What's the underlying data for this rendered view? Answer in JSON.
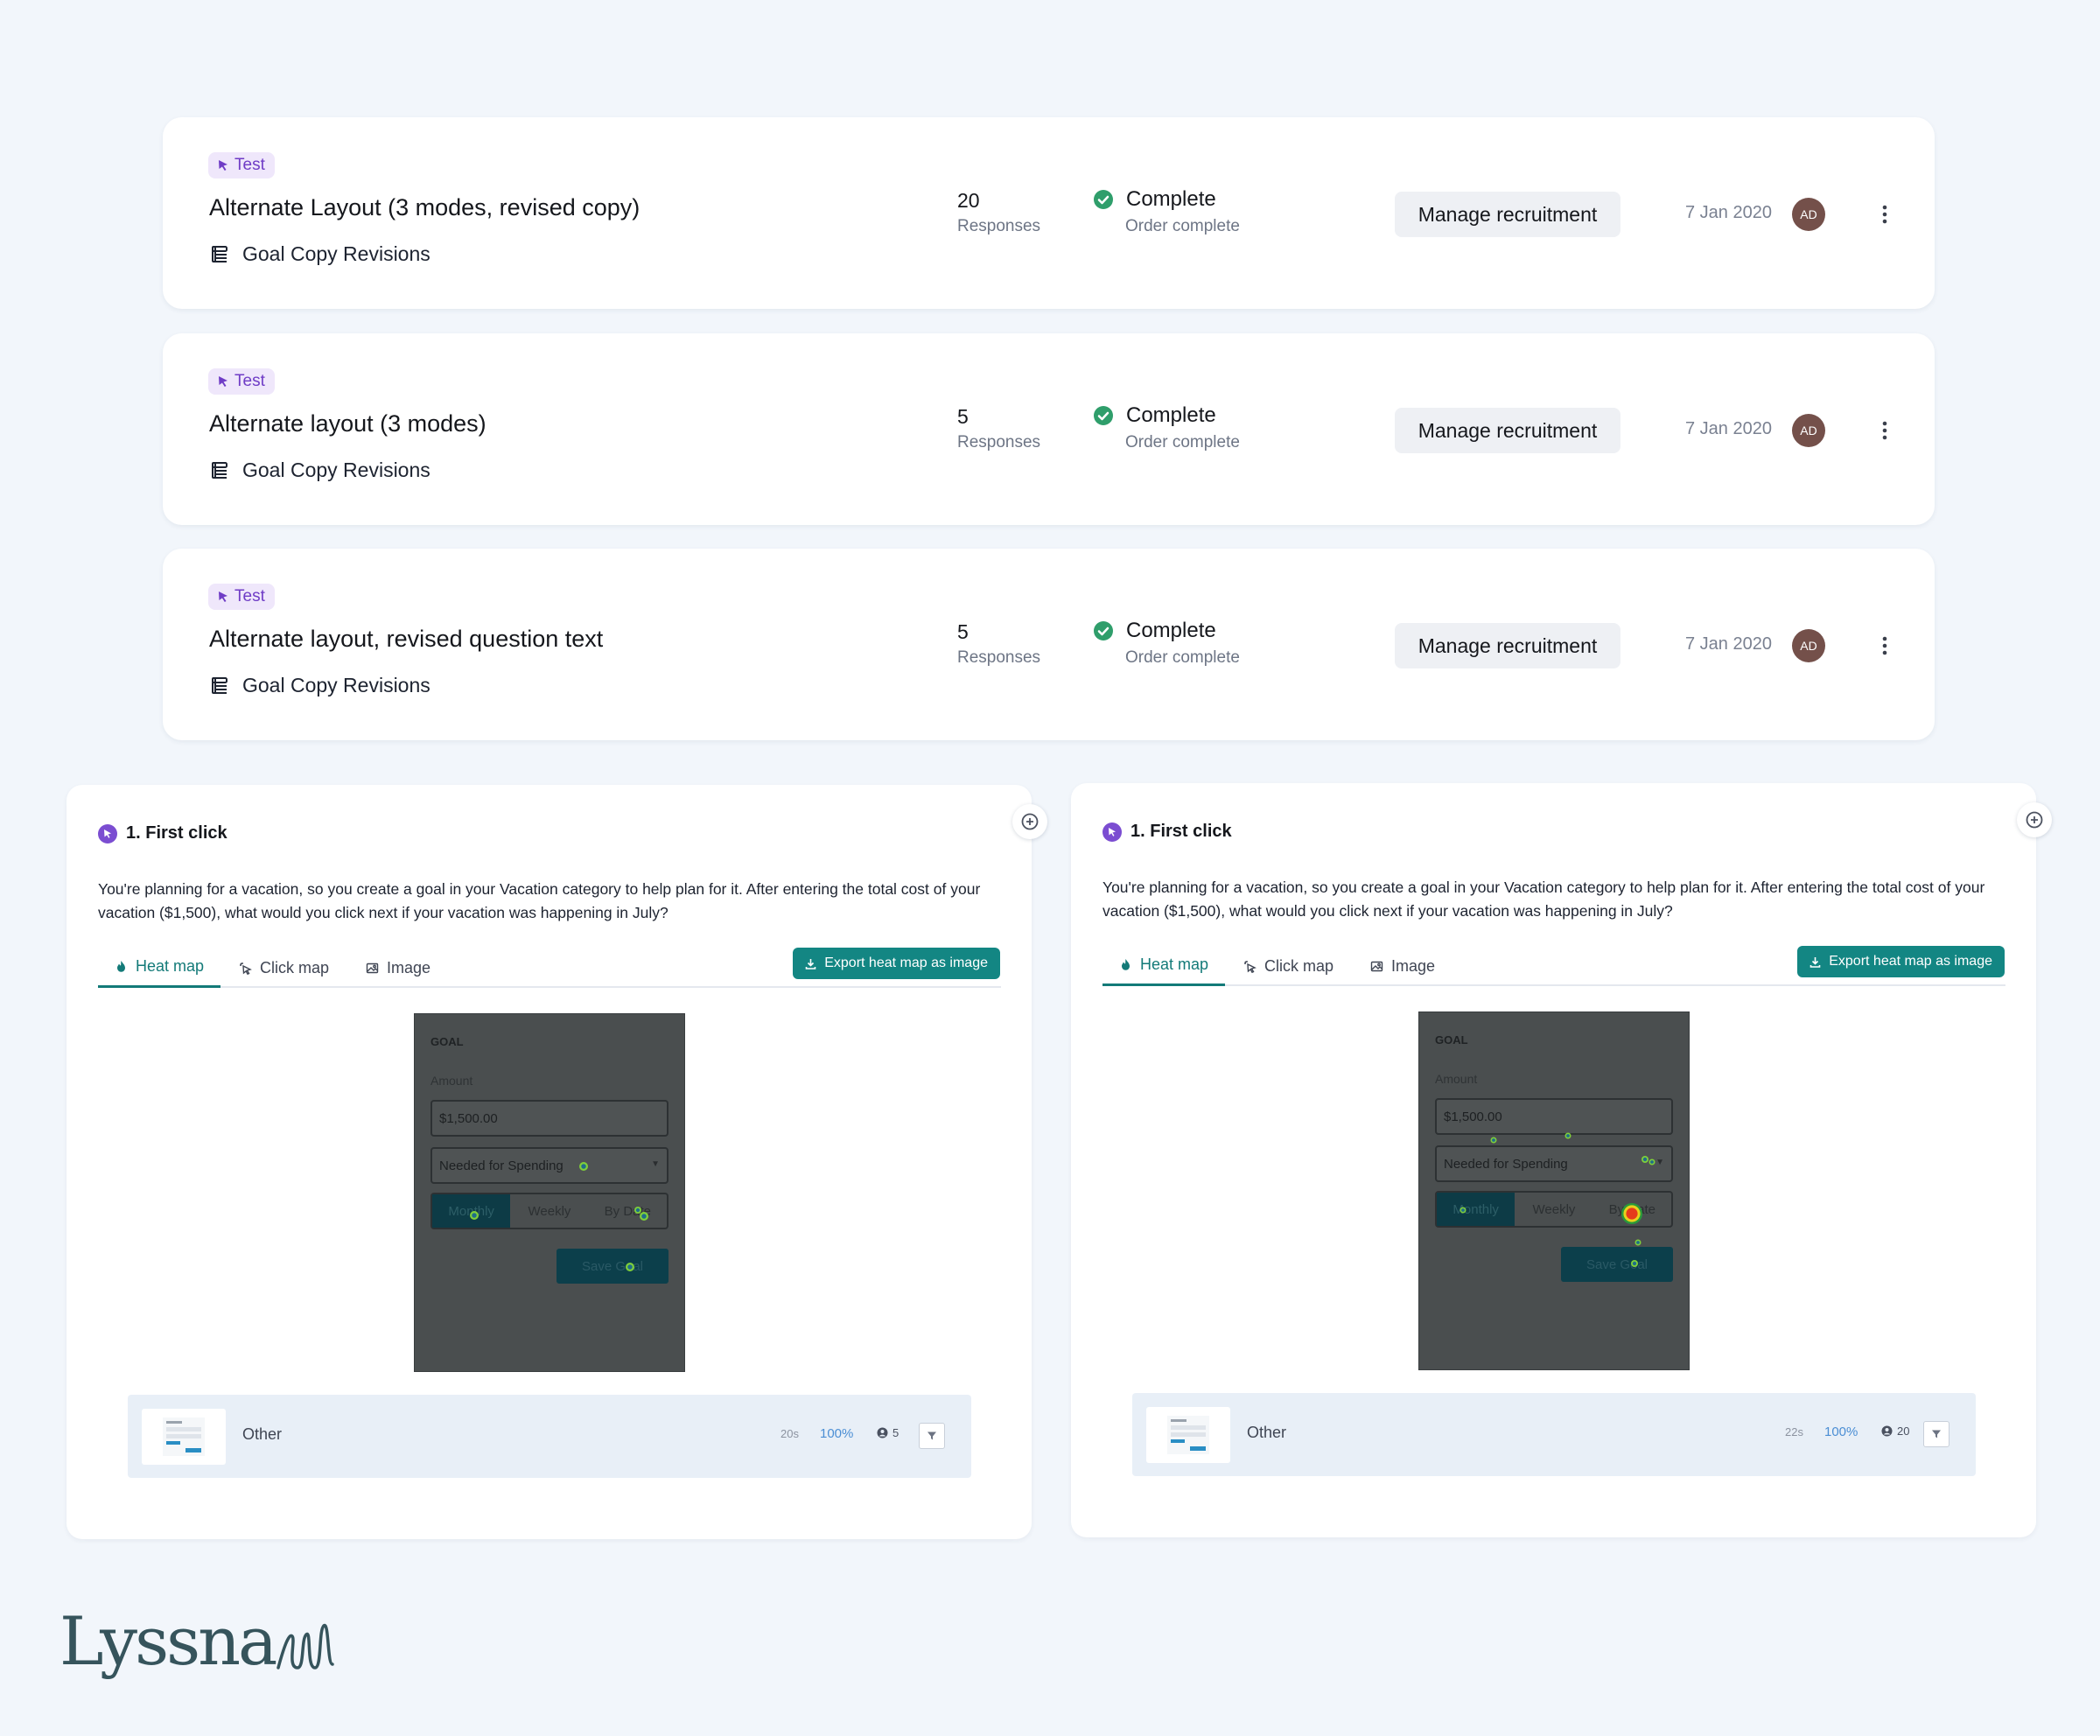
{
  "tests": [
    {
      "badge": "Test",
      "title": "Alternate Layout (3 modes, revised copy)",
      "project": "Goal Copy Revisions",
      "responses_count": "20",
      "responses_label": "Responses",
      "status": "Complete",
      "status_detail": "Order complete",
      "action_label": "Manage recruitment",
      "date": "7 Jan 2020",
      "avatar_initials": "AD"
    },
    {
      "badge": "Test",
      "title": "Alternate layout (3 modes)",
      "project": "Goal Copy Revisions",
      "responses_count": "5",
      "responses_label": "Responses",
      "status": "Complete",
      "status_detail": "Order complete",
      "action_label": "Manage recruitment",
      "date": "7 Jan 2020",
      "avatar_initials": "AD"
    },
    {
      "badge": "Test",
      "title": "Alternate layout, revised question text",
      "project": "Goal Copy Revisions",
      "responses_count": "5",
      "responses_label": "Responses",
      "status": "Complete",
      "status_detail": "Order complete",
      "action_label": "Manage recruitment",
      "date": "7 Jan 2020",
      "avatar_initials": "AD"
    }
  ],
  "panels": [
    {
      "question_title": "1. First click",
      "question_text": "You're planning for a vacation, so you create a goal in your Vacation category to help plan for it. After entering the total cost of your vacation ($1,500), what would you click next if your vacation was happening in July?",
      "tabs": [
        "Heat map",
        "Click map",
        "Image"
      ],
      "active_tab": "Heat map",
      "export_label": "Export heat map as image",
      "screen": {
        "heading": "GOAL",
        "amount_label": "Amount",
        "amount_value": "$1,500.00",
        "spending_value": "Needed for Spending",
        "segments": [
          "Monthly",
          "Weekly",
          "By Date"
        ],
        "save_label": "Save Goal"
      },
      "result": {
        "label": "Other",
        "time": "20s",
        "percent": "100%",
        "participants": "5"
      }
    },
    {
      "question_title": "1. First click",
      "question_text": "You're planning for a vacation, so you create a goal in your Vacation category to help plan for it. After entering the total cost of your vacation ($1,500), what would you click next if your vacation was happening in July?",
      "tabs": [
        "Heat map",
        "Click map",
        "Image"
      ],
      "active_tab": "Heat map",
      "export_label": "Export heat map as image",
      "screen": {
        "heading": "GOAL",
        "amount_label": "Amount",
        "amount_value": "$1,500.00",
        "spending_value": "Needed for Spending",
        "segments": [
          "Monthly",
          "Weekly",
          "By Date"
        ],
        "save_label": "Save Goal"
      },
      "result": {
        "label": "Other",
        "time": "22s",
        "percent": "100%",
        "participants": "20"
      }
    }
  ],
  "brand": {
    "name": "Lyssna"
  },
  "colors": {
    "accent": "#138683",
    "badge_purple": "#6f3cc6",
    "status_green": "#2f9e6b",
    "avatar": "#74504a"
  },
  "icons": {
    "badge": "cursor-click-icon",
    "project": "stack-icon",
    "status": "check-circle-icon",
    "more": "vertical-dots-icon",
    "add": "plus-circle-icon",
    "heatmap_tab": "flame-icon",
    "clickmap_tab": "cursor-click-icon",
    "image_tab": "image-icon",
    "export": "download-icon",
    "participants": "user-icon",
    "filter": "filter-icon"
  }
}
